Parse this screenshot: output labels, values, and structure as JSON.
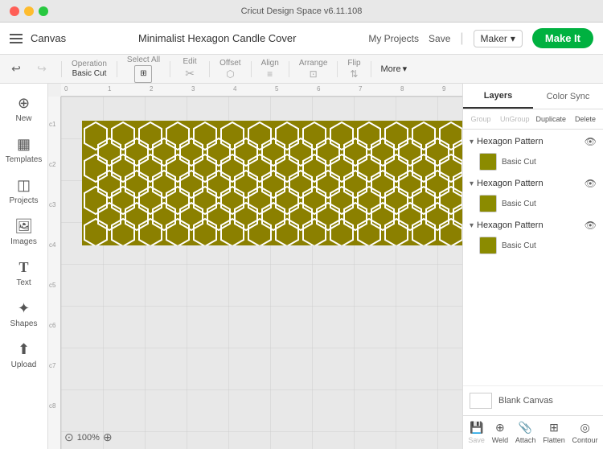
{
  "titlebar": {
    "title": "Cricut Design Space v6.11.108"
  },
  "header": {
    "canvas_label": "Canvas",
    "project_title": "Minimalist Hexagon Candle Cover",
    "my_projects": "My Projects",
    "save": "Save",
    "maker_label": "Maker",
    "make_it": "Make It"
  },
  "toolbar": {
    "operation_label": "Operation",
    "operation_value": "Basic Cut",
    "select_all": "Select All",
    "edit": "Edit",
    "offset": "Offset",
    "align": "Align",
    "arrange": "Arrange",
    "flip": "Flip",
    "more": "More"
  },
  "sidebar": {
    "items": [
      {
        "label": "New",
        "icon": "+"
      },
      {
        "label": "Templates",
        "icon": "▦"
      },
      {
        "label": "Projects",
        "icon": "◫"
      },
      {
        "label": "Images",
        "icon": "🖼"
      },
      {
        "label": "Text",
        "icon": "T"
      },
      {
        "label": "Shapes",
        "icon": "✦"
      },
      {
        "label": "Upload",
        "icon": "↑"
      }
    ]
  },
  "layers_panel": {
    "tabs": [
      "Layers",
      "Color Sync"
    ],
    "actions": [
      "Group",
      "UnGroup",
      "Duplicate",
      "Delete"
    ],
    "layers": [
      {
        "name": "Hexagon Pattern",
        "expanded": true,
        "children": [
          {
            "name": "Basic Cut",
            "color": "#8b8b00"
          }
        ]
      },
      {
        "name": "Hexagon Pattern",
        "expanded": true,
        "children": [
          {
            "name": "Basic Cut",
            "color": "#8b8b00"
          }
        ]
      },
      {
        "name": "Hexagon Pattern",
        "expanded": true,
        "children": [
          {
            "name": "Basic Cut",
            "color": "#8b8b00"
          }
        ]
      }
    ],
    "blank_canvas": "Blank Canvas",
    "bottom_buttons": [
      "Save",
      "Weld",
      "Attach",
      "Flatten",
      "Contour"
    ]
  },
  "canvas": {
    "zoom": "100%",
    "ruler_marks": [
      "0",
      "1",
      "2",
      "3",
      "4",
      "5",
      "6",
      "7",
      "8",
      "9"
    ],
    "ruler_marks_v": [
      "c1",
      "c2",
      "c3",
      "c4",
      "c5",
      "c6",
      "c7",
      "c8"
    ]
  }
}
